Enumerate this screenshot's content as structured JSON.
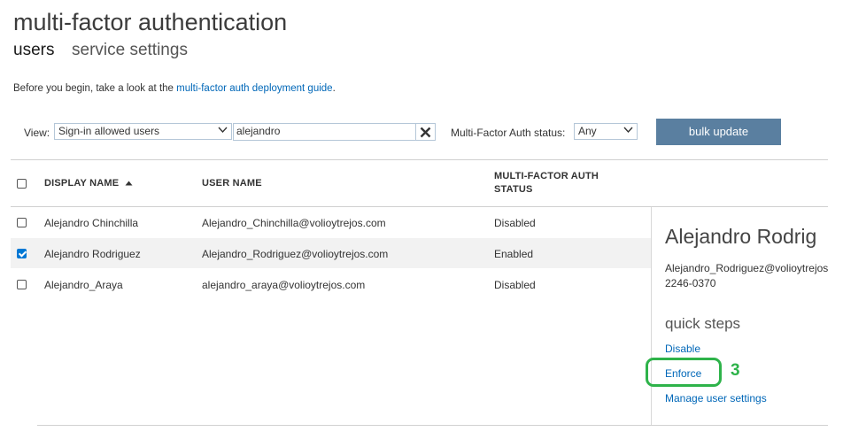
{
  "header": {
    "title": "multi-factor authentication",
    "tabs": [
      "users",
      "service settings"
    ]
  },
  "intro": {
    "prefix": "Before you begin, take a look at the ",
    "link": "multi-factor auth deployment guide",
    "suffix": "."
  },
  "filters": {
    "view_label": "View:",
    "view_value": "Sign-in allowed users",
    "search_value": "alejandro",
    "status_label": "Multi-Factor Auth status:",
    "status_value": "Any",
    "bulk_update_label": "bulk update"
  },
  "table": {
    "columns": {
      "display_name": "DISPLAY NAME",
      "user_name": "USER NAME",
      "mfa_status_line1": "MULTI-FACTOR AUTH",
      "mfa_status_line2": "STATUS"
    },
    "rows": [
      {
        "display_name": "Alejandro Chinchilla",
        "user_name": "Alejandro_Chinchilla@volioytrejos.com",
        "status": "Disabled",
        "checked": false
      },
      {
        "display_name": "Alejandro Rodriguez",
        "user_name": "Alejandro_Rodriguez@volioytrejos.com",
        "status": "Enabled",
        "checked": true
      },
      {
        "display_name": "Alejandro_Araya",
        "user_name": "alejandro_araya@volioytrejos.com",
        "status": "Disabled",
        "checked": false
      }
    ]
  },
  "details": {
    "name": "Alejandro Rodrig",
    "email": "Alejandro_Rodriguez@volioytrejos",
    "phone": "2246-0370",
    "quick_steps_heading": "quick steps",
    "disable_label": "Disable",
    "enforce_label": "Enforce",
    "manage_label": "Manage user settings"
  },
  "annotation": {
    "step_number": "3",
    "color": "#2eb34a"
  },
  "colors": {
    "accent_button": "#5a7fa0",
    "link": "#0067b8",
    "checkbox_checked": "#0078d4",
    "selected_row": "#f2f2f2"
  }
}
